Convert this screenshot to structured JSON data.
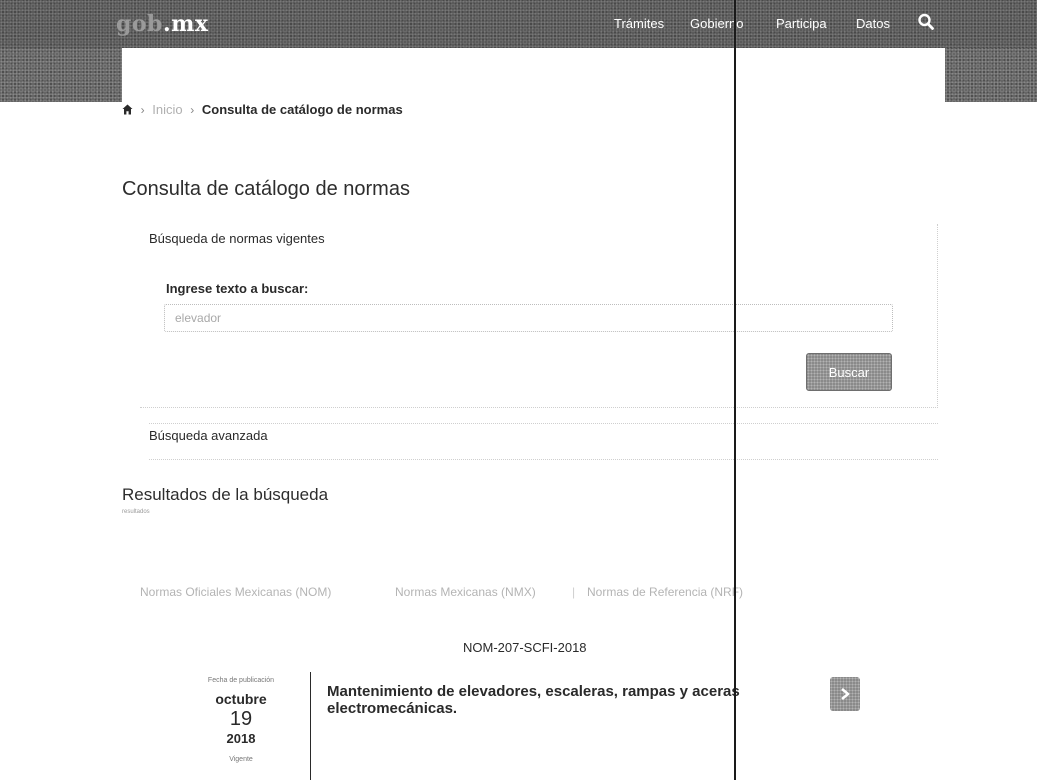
{
  "header": {
    "logo_prefix": "gob",
    "logo_suffix": ".mx",
    "nav": [
      {
        "label": "Trámites"
      },
      {
        "label": "Gobierno"
      },
      {
        "label": "Participa"
      },
      {
        "label": "Datos"
      }
    ],
    "search_icon": "search-icon"
  },
  "breadcrumb": {
    "home_icon": "home-icon",
    "home_label": "Inicio",
    "current": "Consulta de catálogo de normas"
  },
  "page": {
    "title": "Consulta de catálogo de normas"
  },
  "search": {
    "section_label": "Búsqueda de normas vigentes",
    "field_label": "Ingrese texto a buscar:",
    "input_value": "elevador",
    "button_label": "Buscar",
    "advanced_label": "Búsqueda avanzada"
  },
  "results": {
    "title": "Resultados de la búsqueda",
    "subtitle": "resultados",
    "tabs": [
      {
        "label": "Normas Oficiales Mexicanas (NOM)"
      },
      {
        "label": "Normas Mexicanas (NMX)"
      },
      {
        "label": "Normas de Referencia (NRF)"
      }
    ],
    "items": [
      {
        "code": "NOM-207-SCFI-2018",
        "date_label": "Fecha de publicación",
        "month": "octubre",
        "day": "19",
        "year": "2018",
        "status": "Vigente",
        "description": "Mantenimiento de elevadores, escaleras, rampas y aceras electromecánicas.",
        "action_icon": "chevron-right-icon"
      }
    ]
  },
  "colors": {
    "header_bg": "#5a5a5a",
    "button_bg": "#8a8a8a",
    "text": "#2a2a2a"
  }
}
